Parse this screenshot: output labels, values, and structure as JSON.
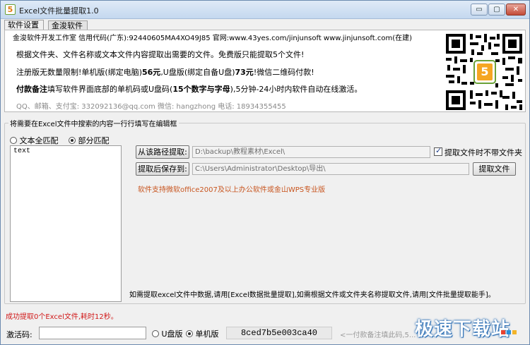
{
  "window": {
    "title": "Excel文件批量提取1.0",
    "app_icon_glyph": "5",
    "minimize_glyph": "▭",
    "maximize_glyph": "▢",
    "close_glyph": "✕"
  },
  "tabs": [
    {
      "label": "软件设置",
      "active": true
    },
    {
      "label": "金浚软件",
      "active": false
    }
  ],
  "info": {
    "company_line": "金浚软件开发工作室 信用代码(广东):92440605MA4XO49J85 官网:www.43yes.com/jinjunsoft  www.jinjunsoft.com(在建)",
    "line1": "根据文件夹、文件名称或文本文件内容提取出需要的文件。免费版只能提取5个文件!",
    "line2_prefix": "注册版无数量限制!单机版(绑定电脑)",
    "line2_price1": "56元",
    "line2_mid": ",U盘版(绑定自备U盘)",
    "line2_price2": "73元",
    "line2_suffix": "!微信二维码付款!",
    "line3_bold1": "付款备注",
    "line3_mid": "填写软件界面底部的单机码或U盘码(",
    "line3_bold2": "15个数字与字母",
    "line3_suffix": "),5分钟-24小时内软件自动在线激活。",
    "contact": "QQ、邮箱、支付宝: 332092136@qq.com   微信: hangzhong  电话: 18934355455",
    "qr_badge": "5"
  },
  "search_group": {
    "title": "将需要在Excel文件中搜索的内容一行行填写在编辑框",
    "radio_full": "文本全匹配",
    "radio_partial": "部分匹配",
    "selected": "部分匹配",
    "keywords_text": "text"
  },
  "paths": {
    "source_button": "从该路径提取:",
    "source_path": "D:\\backup\\教程素材\\Excel\\",
    "dest_button": "提取后保存到:",
    "dest_path": "C:\\Users\\Administrator\\Desktop\\导出\\",
    "no_folder_checkbox": "提取文件时不带文件夹",
    "no_folder_checked": true,
    "extract_button": "提取文件"
  },
  "support_note": "软件支持微软office2007及以上办公软件或金山WPS专业版",
  "bottom_note": "如需提取excel文件中数据,请用[Excel数据批量提取],如需根据文件或文件夹名称提取文件,请用[文件批量提取能手]。",
  "status": "成功提取0个Excel文件,耗时12秒。",
  "activation": {
    "label": "激活码:",
    "code_value": "",
    "radio_usb": "U盘版",
    "radio_pc": "单机版",
    "selected": "单机版",
    "machine_code": "8ced7b5e003ca40",
    "hint": "<一付款备注填此码,5..."
  },
  "watermark": {
    "text": "极速下载站",
    "colors": [
      "#e8432f",
      "#2b8fd8",
      "#f2b42a"
    ]
  },
  "colors": {
    "status_red": "#d11a1a",
    "note_orange": "#c8551f"
  }
}
